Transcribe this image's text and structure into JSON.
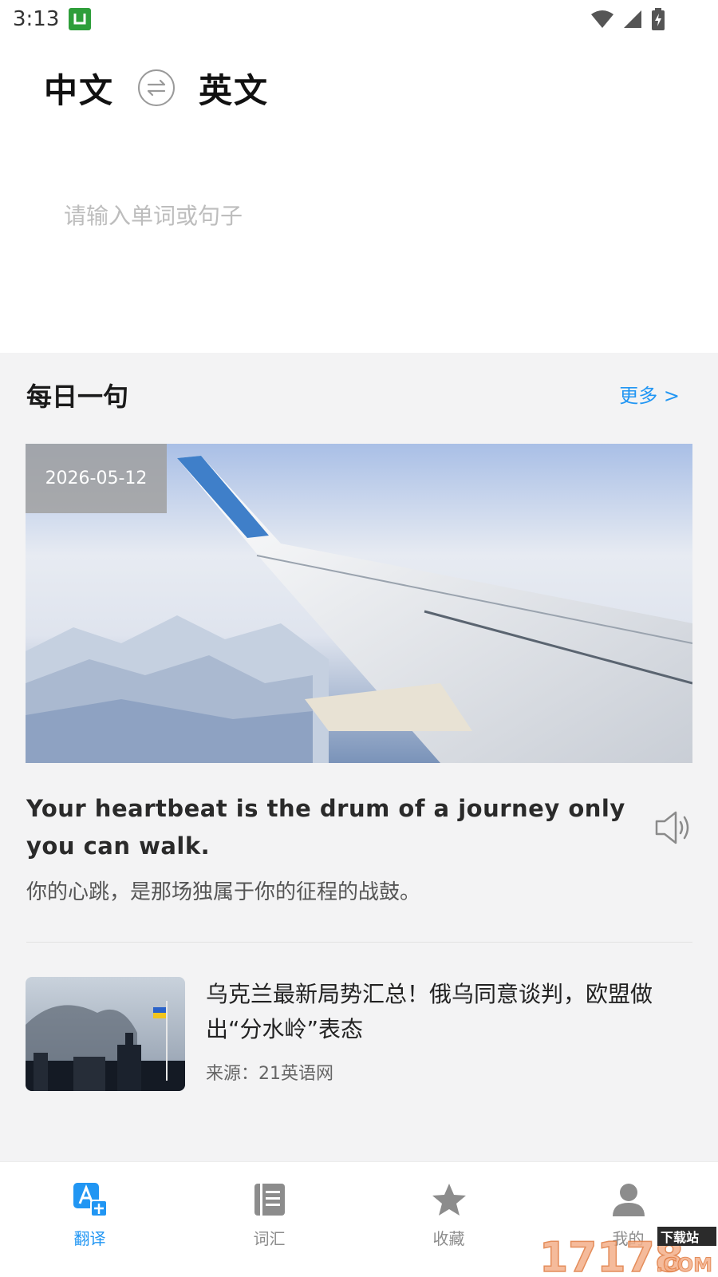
{
  "status_bar": {
    "time": "3:13",
    "app_icon_letter": "U",
    "icons": [
      "wifi-icon",
      "signal-icon",
      "battery-charging-icon"
    ]
  },
  "language": {
    "source": "中文",
    "target": "英文",
    "swap_icon": "swap-icon"
  },
  "input": {
    "placeholder": "请输入单词或句子",
    "value": ""
  },
  "daily": {
    "title": "每日一句",
    "more": "更多 >",
    "date": "2026-05-12",
    "quote_en": "Your heartbeat is the drum of a journey only you can walk.",
    "quote_cn": "你的心跳，是那场独属于你的征程的战鼓。"
  },
  "news": [
    {
      "title": "乌克兰最新局势汇总！俄乌同意谈判，欧盟做出“分水岭”表态",
      "source": "来源：21英语网"
    }
  ],
  "tabs": [
    {
      "label": "翻译",
      "icon": "translate-icon",
      "active": true
    },
    {
      "label": "词汇",
      "icon": "book-icon",
      "active": false
    },
    {
      "label": "收藏",
      "icon": "star-icon",
      "active": false
    },
    {
      "label": "我的",
      "icon": "user-icon",
      "active": false
    }
  ],
  "watermark": {
    "text": "17178",
    "sub": "下载站",
    "domain": ".COM"
  },
  "colors": {
    "accent": "#2196f3",
    "background_grey": "#f3f3f4",
    "tab_inactive": "#8c8c8c"
  }
}
